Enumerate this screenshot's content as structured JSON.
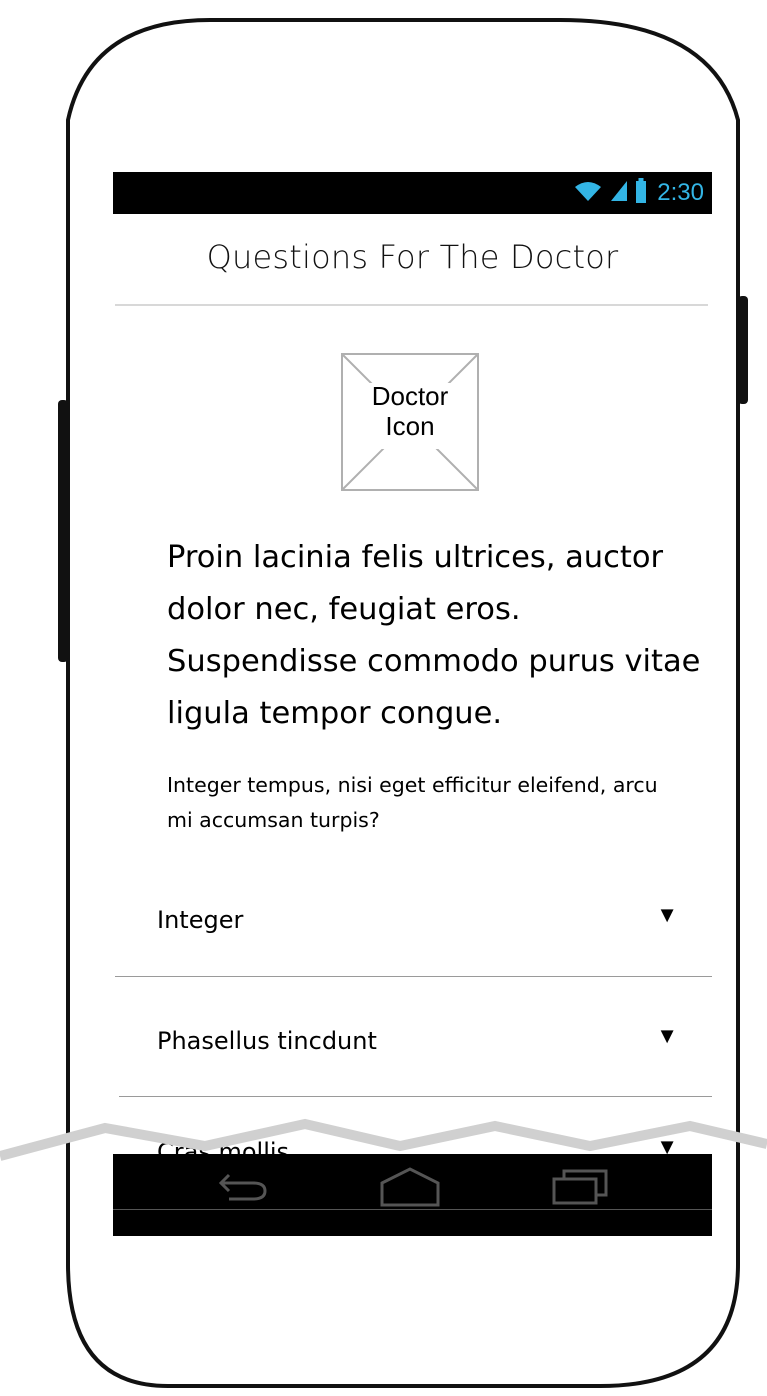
{
  "status_bar": {
    "time": "2:30",
    "icons": [
      "wifi-icon",
      "signal-icon",
      "battery-icon"
    ],
    "accent": "#33b5e5"
  },
  "header": {
    "title": "Questions For The Doctor"
  },
  "doctor_icon": {
    "label_line1": "Doctor",
    "label_line2": "Icon"
  },
  "content": {
    "lead_text": "Proin lacinia felis ultrices, auctor dolor nec, feugiat eros. Suspendisse commodo purus vitae ligula tempor congue.",
    "question_text": "Integer tempus, nisi eget efficitur eleifend, arcu mi accumsan turpis?"
  },
  "dropdowns": [
    {
      "label": "Integer",
      "arrow": "▼"
    },
    {
      "label": "Phasellus tincdunt",
      "arrow": "▼"
    },
    {
      "label": "Cras mollis",
      "arrow": "▼"
    }
  ],
  "nav_bar": {
    "buttons": [
      "back-icon",
      "home-icon",
      "recent-apps-icon"
    ]
  }
}
